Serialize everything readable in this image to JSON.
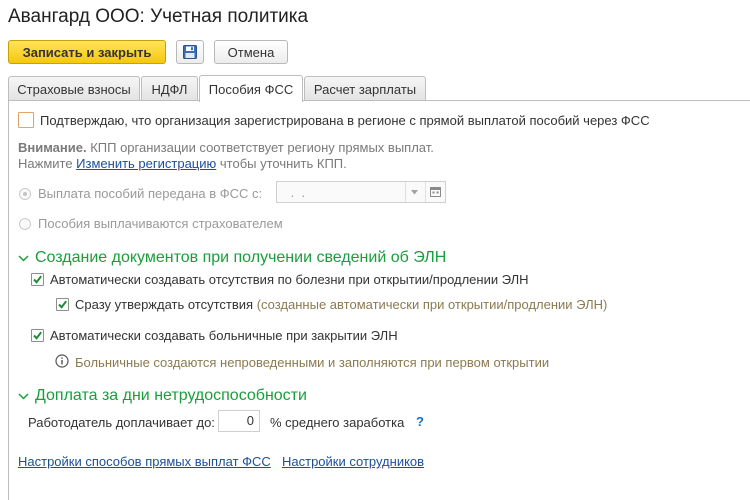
{
  "window": {
    "title": "Авангард ООО: Учетная политика"
  },
  "toolbar": {
    "save_close_label": "Записать и закрыть",
    "cancel_label": "Отмена"
  },
  "tabs": [
    {
      "label": "Страховые взносы"
    },
    {
      "label": "НДФЛ"
    },
    {
      "label": "Пособия ФСС"
    },
    {
      "label": "Расчет зарплаты"
    }
  ],
  "fss": {
    "confirm_label": "Подтверждаю, что организация зарегистрирована в регионе с прямой выплатой пособий через ФСС",
    "attention_bold": "Внимание.",
    "attention_text": " КПП организации соответствует региону прямых выплат.",
    "press_prefix": "Нажмите ",
    "press_link": "Изменить регистрацию",
    "press_suffix": " чтобы уточнить КПП.",
    "radio_transferred": "Выплата пособий передана в ФСС с:",
    "date_placeholder": " .  .",
    "radio_insurer": "Пособия выплачиваются страхователем"
  },
  "eln": {
    "heading": "Создание документов при получении сведений об ЭЛН",
    "auto_absence": "Автоматически создавать отсутствия по болезни при открытии/продлении ЭЛН",
    "approve_main": "Сразу утверждать отсутствия",
    "approve_hint": " (созданные автоматически при открытии/продлении ЭЛН)",
    "auto_sick": "Автоматически создавать больничные при закрытии ЭЛН",
    "sick_info": "Больничные создаются непроведенными и заполняются при первом открытии"
  },
  "extra": {
    "heading": "Доплата за дни нетрудоспособности",
    "label": "Работодатель доплачивает до:",
    "value": "0",
    "suffix": "% среднего заработка",
    "help": "?"
  },
  "links": {
    "direct_payments": "Настройки способов прямых выплат ФСС",
    "employees": "Настройки сотрудников"
  }
}
